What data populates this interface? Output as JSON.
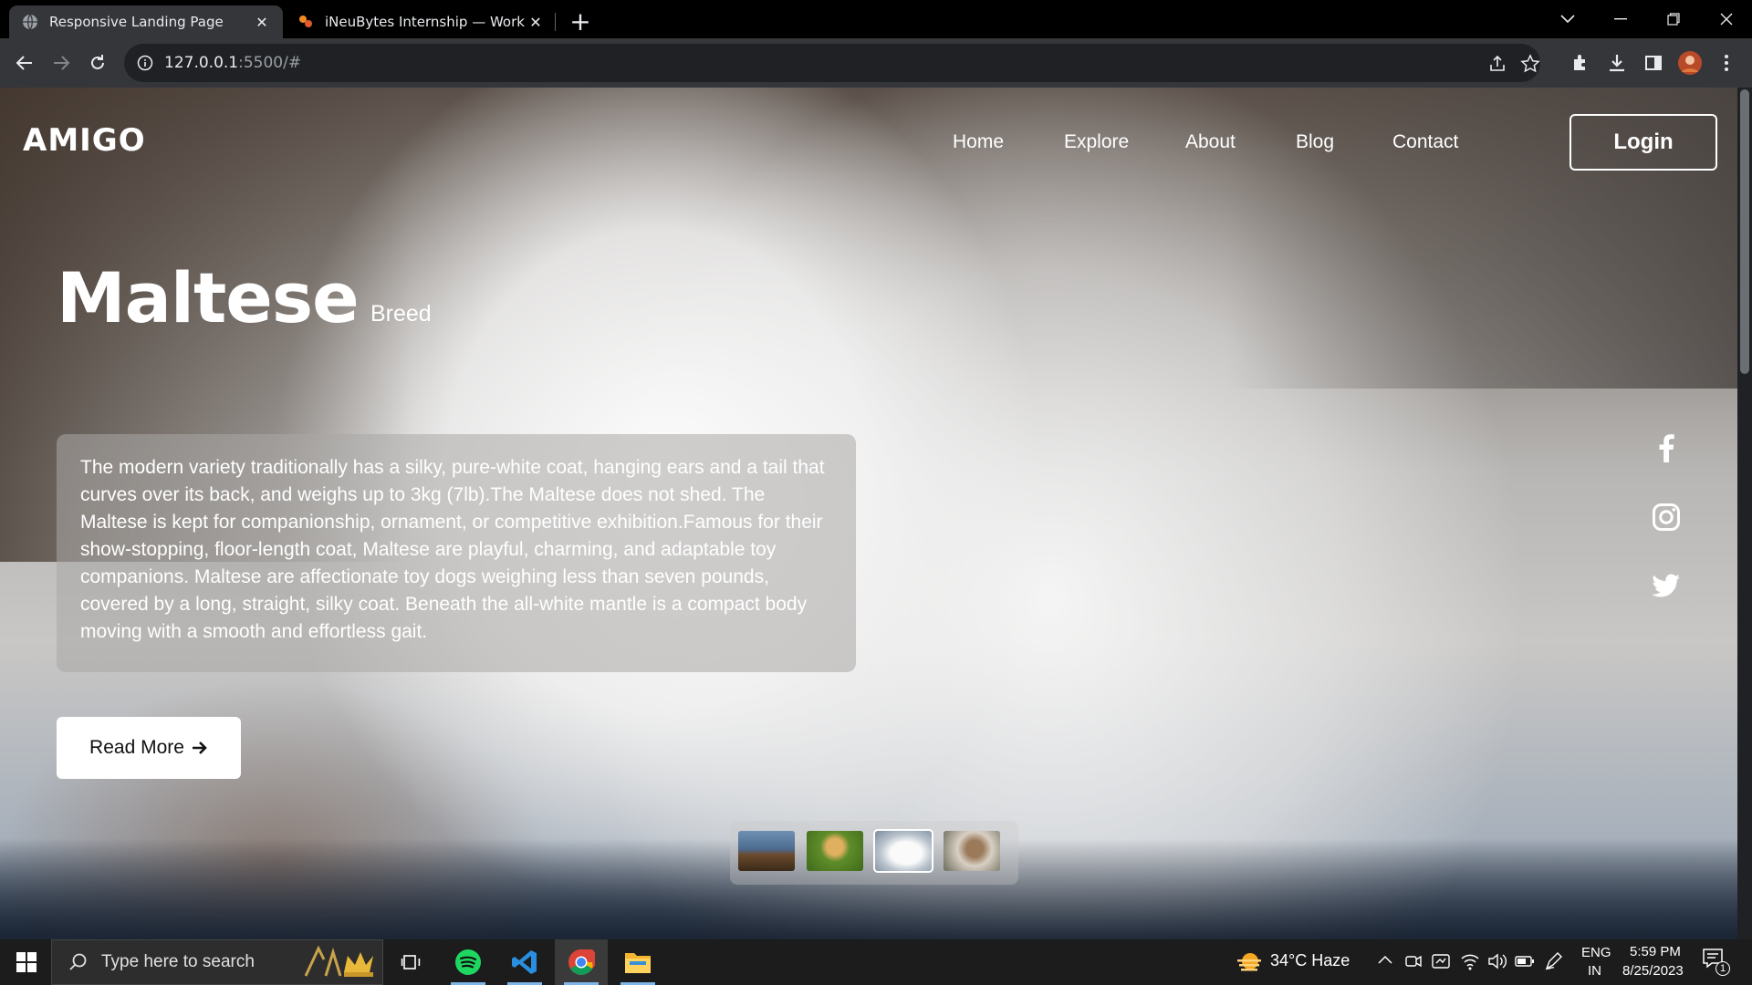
{
  "browser": {
    "tabs": [
      {
        "title": "Responsive Landing Page",
        "active": true
      },
      {
        "title": "iNeuBytes Internship — Work and",
        "active": false
      }
    ],
    "url_host": "127.0.0.1",
    "url_rest": ":5500/#"
  },
  "site": {
    "logo": "AMIGO",
    "nav": [
      "Home",
      "Explore",
      "About",
      "Blog",
      "Contact"
    ],
    "login_label": "Login",
    "hero_title": "Maltese",
    "hero_subtitle": "Breed",
    "description": "The modern variety traditionally has a silky, pure-white coat, hanging ears and a tail that curves over its back, and weighs up to 3kg (7lb).The Maltese does not shed. The Maltese is kept for companionship, ornament, or competitive exhibition.Famous for their show-stopping, floor-length coat, Maltese are playful, charming, and adaptable toy companions. Maltese are affectionate toy dogs weighing less than seven pounds, covered by a long, straight, silky coat. Beneath the all-white mantle is a compact body moving with a smooth and effortless gait.",
    "read_more_label": "Read More",
    "social": [
      "facebook-icon",
      "instagram-icon",
      "twitter-icon"
    ],
    "thumbnails": [
      "german-shepherd",
      "golden-puppy",
      "maltese",
      "terrier"
    ]
  },
  "taskbar": {
    "search_placeholder": "Type here to search",
    "weather": "34°C  Haze",
    "lang_top": "ENG",
    "lang_bottom": "IN",
    "time": "5:59 PM",
    "date": "8/25/2023",
    "notification_count": "1"
  }
}
